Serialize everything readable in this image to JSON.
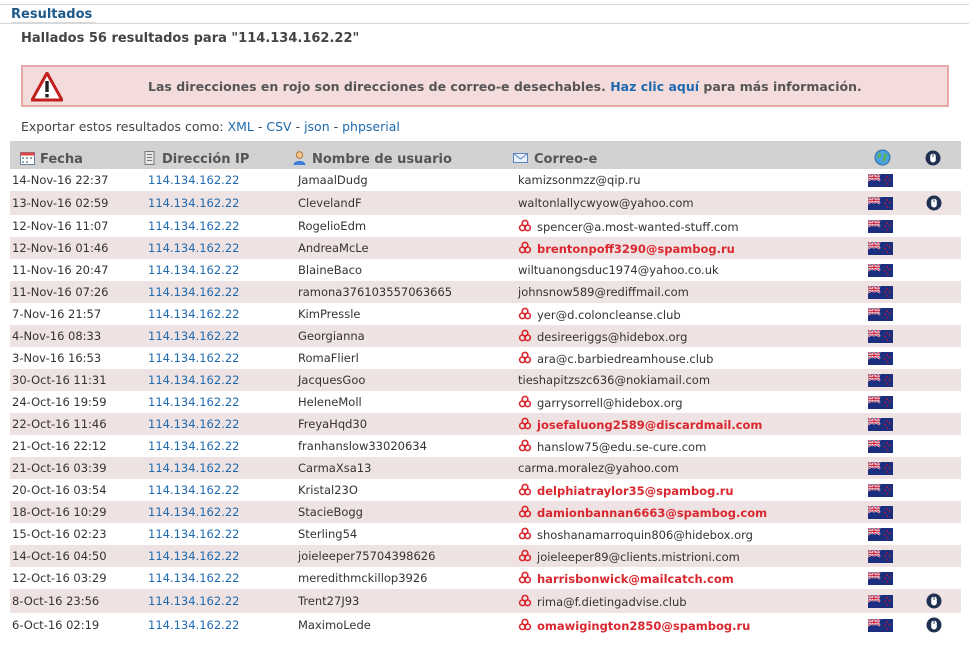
{
  "section_title": "Resultados",
  "found_text": "Hallados 56 resultados para \"114.134.162.22\"",
  "alert": {
    "text_before": "Las direcciones en rojo son direcciones de correo-e desechables.",
    "link": "Haz clic aquí",
    "text_after": "para más información."
  },
  "export": {
    "label": "Exportar estos resultados como:",
    "formats": [
      "XML",
      "CSV",
      "json",
      "phpserial"
    ],
    "sep": "-"
  },
  "table": {
    "headers": [
      "Fecha",
      "Dirección IP",
      "Nombre de usuario",
      "Correo-e"
    ],
    "rows": [
      {
        "date": "14-Nov-16 22:37",
        "ip": "114.134.162.22",
        "user": "JamaalDudg",
        "email": "kamizsonmzz@qip.ru",
        "kind": "normal",
        "mouse": false
      },
      {
        "date": "13-Nov-16 02:59",
        "ip": "114.134.162.22",
        "user": "ClevelandF",
        "email": "waltonlallycwyow@yahoo.com",
        "kind": "normal",
        "mouse": true
      },
      {
        "date": "12-Nov-16 11:07",
        "ip": "114.134.162.22",
        "user": "RogelioEdm",
        "email": "spencer@a.most-wanted-stuff.com",
        "kind": "bio",
        "mouse": false
      },
      {
        "date": "12-Nov-16 01:46",
        "ip": "114.134.162.22",
        "user": "AndreaMcLe",
        "email": "brentonpoff3290@spambog.ru",
        "kind": "red",
        "mouse": false
      },
      {
        "date": "11-Nov-16 20:47",
        "ip": "114.134.162.22",
        "user": "BlaineBaco",
        "email": "wiltuanongsduc1974@yahoo.co.uk",
        "kind": "normal",
        "mouse": false
      },
      {
        "date": "11-Nov-16 07:26",
        "ip": "114.134.162.22",
        "user": "ramona376103557063665",
        "email": "johnsnow589@rediffmail.com",
        "kind": "normal",
        "mouse": false
      },
      {
        "date": "7-Nov-16 21:57",
        "ip": "114.134.162.22",
        "user": "KimPressle",
        "email": "yer@d.coloncleanse.club",
        "kind": "bio",
        "mouse": false
      },
      {
        "date": "4-Nov-16 08:33",
        "ip": "114.134.162.22",
        "user": "Georgianna",
        "email": "desireeriggs@hidebox.org",
        "kind": "bio",
        "mouse": false
      },
      {
        "date": "3-Nov-16 16:53",
        "ip": "114.134.162.22",
        "user": "RomaFlierl",
        "email": "ara@c.barbiedreamhouse.club",
        "kind": "bio",
        "mouse": false
      },
      {
        "date": "30-Oct-16 11:31",
        "ip": "114.134.162.22",
        "user": "JacquesGoo",
        "email": "tieshapitzszc636@nokiamail.com",
        "kind": "normal",
        "mouse": false
      },
      {
        "date": "24-Oct-16 19:59",
        "ip": "114.134.162.22",
        "user": "HeleneMoll",
        "email": "garrysorrell@hidebox.org",
        "kind": "bio",
        "mouse": false
      },
      {
        "date": "22-Oct-16 11:46",
        "ip": "114.134.162.22",
        "user": "FreyaHqd30",
        "email": "josefaluong2589@discardmail.com",
        "kind": "red",
        "mouse": false
      },
      {
        "date": "21-Oct-16 22:12",
        "ip": "114.134.162.22",
        "user": "franhanslow33020634",
        "email": "hanslow75@edu.se-cure.com",
        "kind": "bio",
        "mouse": false
      },
      {
        "date": "21-Oct-16 03:39",
        "ip": "114.134.162.22",
        "user": "CarmaXsa13",
        "email": "carma.moralez@yahoo.com",
        "kind": "normal",
        "mouse": false
      },
      {
        "date": "20-Oct-16 03:54",
        "ip": "114.134.162.22",
        "user": "Kristal23O",
        "email": "delphiatraylor35@spambog.ru",
        "kind": "red",
        "mouse": false
      },
      {
        "date": "18-Oct-16 10:29",
        "ip": "114.134.162.22",
        "user": "StacieBogg",
        "email": "damionbannan6663@spambog.com",
        "kind": "red",
        "mouse": false
      },
      {
        "date": "15-Oct-16 02:23",
        "ip": "114.134.162.22",
        "user": "Sterling54",
        "email": "shoshanamarroquin806@hidebox.org",
        "kind": "bio",
        "mouse": false
      },
      {
        "date": "14-Oct-16 04:50",
        "ip": "114.134.162.22",
        "user": "joieleeper75704398626",
        "email": "joieleeper89@clients.mistrioni.com",
        "kind": "bio",
        "mouse": false
      },
      {
        "date": "12-Oct-16 03:29",
        "ip": "114.134.162.22",
        "user": "meredithmckillop3926",
        "email": "harrisbonwick@mailcatch.com",
        "kind": "red",
        "mouse": false
      },
      {
        "date": "8-Oct-16 23:56",
        "ip": "114.134.162.22",
        "user": "Trent27J93",
        "email": "rima@f.dietingadvise.club",
        "kind": "bio",
        "mouse": true
      },
      {
        "date": "6-Oct-16 02:19",
        "ip": "114.134.162.22",
        "user": "MaximoLede",
        "email": "omawigington2850@spambog.ru",
        "kind": "red",
        "mouse": true
      }
    ]
  }
}
